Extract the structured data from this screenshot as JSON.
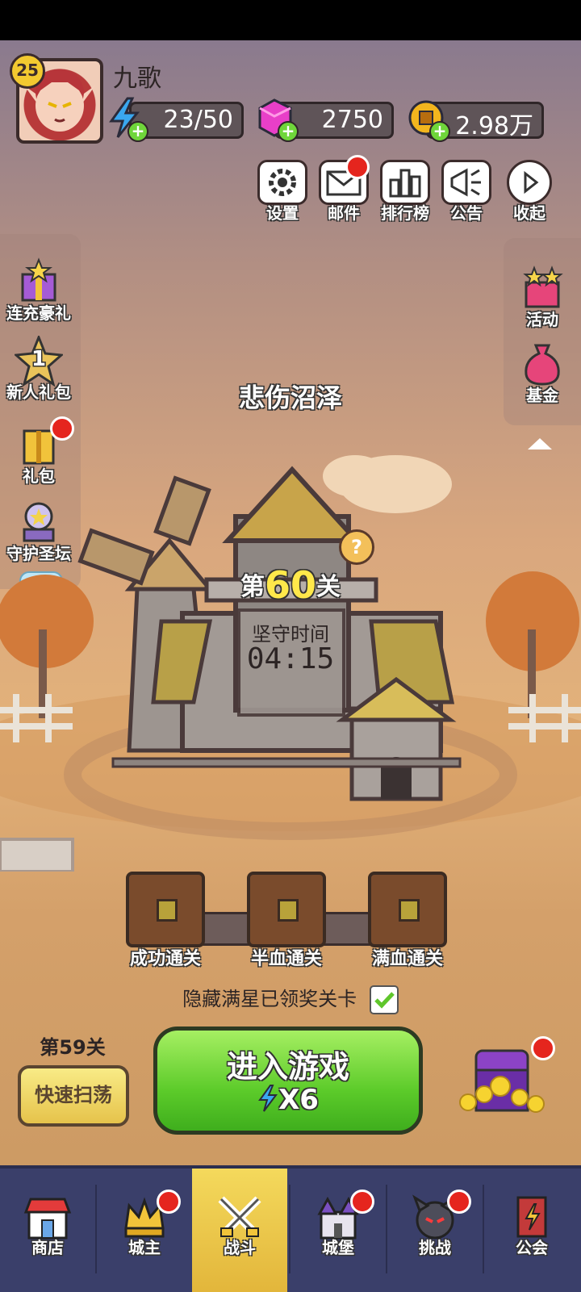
{
  "player": {
    "level": "25",
    "name": "九歌"
  },
  "resources": {
    "stamina": "23/50",
    "gems": "2750",
    "gold": "2.98万"
  },
  "top_menu": {
    "settings": "设置",
    "mail": "邮件",
    "ranking": "排行榜",
    "notice": "公告",
    "collapse": "收起"
  },
  "left_menu": {
    "recharge_gift": "连充豪礼",
    "newbie_pack": "新人礼包",
    "newbie_pack_number": "1",
    "gift_pack": "礼包",
    "guardian_altar": "守护圣坛"
  },
  "right_menu": {
    "activity": "活动",
    "fund": "基金"
  },
  "stage": {
    "title": "悲伤沼泽",
    "level_prefix": "第",
    "level_number": "60",
    "level_suffix": "关",
    "hold_label": "坚守时间",
    "hold_time": "04:15"
  },
  "chests": {
    "success": "成功通关",
    "half_hp": "半血通关",
    "full_hp": "满血通关"
  },
  "hidden_star_label": "隐藏满星已领奖关卡",
  "actions": {
    "previous_level": "第59关",
    "sweep": "快速扫荡",
    "enter_game": "进入游戏",
    "enter_cost": "X6"
  },
  "nav": {
    "shop": "商店",
    "lord": "城主",
    "battle": "战斗",
    "castle": "城堡",
    "challenge": "挑战",
    "guild": "公会"
  },
  "colors": {
    "enter_button": "#5ccb2a",
    "nav_bg": "#3a3f6a",
    "active_tab": "#f4d95c",
    "badge_red": "#e5251e"
  }
}
